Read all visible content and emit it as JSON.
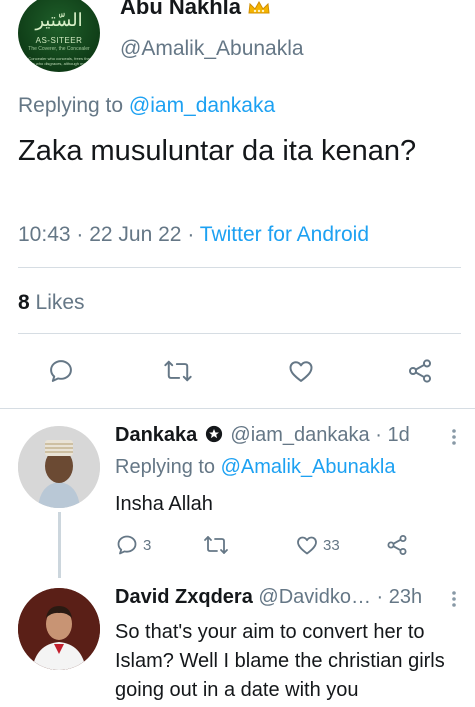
{
  "main": {
    "author": {
      "display_name": "Abu Nakhla",
      "handle": "@Amalik_Abunakla",
      "avatar_text": {
        "title": "السّتير",
        "subtitle": "AS-SITEER",
        "caption": "The Coverer, the Concealer",
        "small": "Concealer who conceals, frees the one who disgraces, although many"
      }
    },
    "replying_prefix": "Replying to",
    "replying_handle": "@iam_dankaka",
    "text": "Zaka musuluntar da ita kenan?",
    "time": "10:43",
    "sep1": " · ",
    "date": "22 Jun 22",
    "sep2": " · ",
    "source": "Twitter for Android",
    "likes_count": "8",
    "likes_label": "Likes"
  },
  "actions": {
    "icons": [
      "comment-icon",
      "retweet-icon",
      "like-icon",
      "share-icon"
    ]
  },
  "replies": [
    {
      "name": "Dankaka",
      "handle": "@iam_dankaka",
      "sep": " · ",
      "time": "1d",
      "replying_prefix": "Replying to",
      "replying_handle": "@Amalik_Abunakla",
      "text": "Insha Allah",
      "reply_count": "3",
      "like_count": "33"
    },
    {
      "name": "David Zxqdera",
      "handle": "@Davidko…",
      "sep": " · ",
      "time": "23h",
      "text": "So that's your aim to convert her to Islam? Well I blame the christian girls going out in a date with you"
    }
  ],
  "colors": {
    "accent": "#1da1f2",
    "secondary_text": "#657786",
    "primary_text": "#14171a",
    "divider": "#d6dde3"
  }
}
